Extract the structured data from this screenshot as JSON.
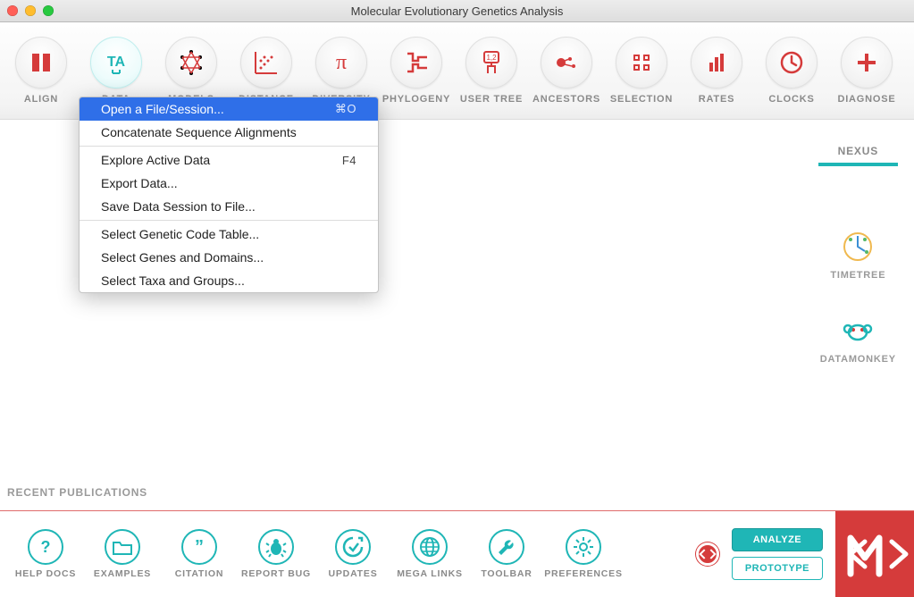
{
  "window": {
    "title": "Molecular Evolutionary Genetics Analysis"
  },
  "toolbar": [
    {
      "label": "ALIGN",
      "icon": "align",
      "hl": false
    },
    {
      "label": "DATA",
      "icon": "data",
      "hl": true
    },
    {
      "label": "MODELS",
      "icon": "models",
      "hl": false
    },
    {
      "label": "DISTANCE",
      "icon": "distance",
      "hl": false
    },
    {
      "label": "DIVERSITY",
      "icon": "diversity",
      "hl": false
    },
    {
      "label": "PHYLOGENY",
      "icon": "phylogeny",
      "hl": false
    },
    {
      "label": "USER TREE",
      "icon": "usertree",
      "hl": false
    },
    {
      "label": "ANCESTORS",
      "icon": "ancestors",
      "hl": false
    },
    {
      "label": "SELECTION",
      "icon": "selection",
      "hl": false
    },
    {
      "label": "RATES",
      "icon": "rates",
      "hl": false
    },
    {
      "label": "CLOCKS",
      "icon": "clocks",
      "hl": false
    },
    {
      "label": "DIAGNOSE",
      "icon": "diagnose",
      "hl": false
    }
  ],
  "menu": {
    "items": [
      {
        "label": "Open a File/Session...",
        "shortcut": "⌘O",
        "selected": true
      },
      {
        "label": "Concatenate Sequence Alignments"
      },
      {
        "sep": true
      },
      {
        "label": "Explore Active Data",
        "shortcut": "F4"
      },
      {
        "label": "Export Data..."
      },
      {
        "label": "Save Data Session to File..."
      },
      {
        "sep": true
      },
      {
        "label": "Select Genetic Code Table..."
      },
      {
        "label": "Select Genes and Domains..."
      },
      {
        "label": "Select Taxa and Groups..."
      }
    ]
  },
  "rightcol": {
    "tab": "NEXUS",
    "links": [
      {
        "label": "TIMETREE",
        "icon": "timetree"
      },
      {
        "label": "DATAMONKEY",
        "icon": "datamonkey"
      }
    ]
  },
  "recent_pubs_label": "RECENT PUBLICATIONS",
  "bottom": [
    {
      "label": "HELP DOCS",
      "icon": "help"
    },
    {
      "label": "EXAMPLES",
      "icon": "folder"
    },
    {
      "label": "CITATION",
      "icon": "quote"
    },
    {
      "label": "REPORT BUG",
      "icon": "bug"
    },
    {
      "label": "UPDATES",
      "icon": "updates"
    },
    {
      "label": "MEGA LINKS",
      "icon": "globe"
    },
    {
      "label": "TOOLBAR",
      "icon": "wrench"
    },
    {
      "label": "PREFERENCES",
      "icon": "gear"
    }
  ],
  "mode_buttons": {
    "analyze": "ANALYZE",
    "prototype": "PROTOTYPE"
  }
}
